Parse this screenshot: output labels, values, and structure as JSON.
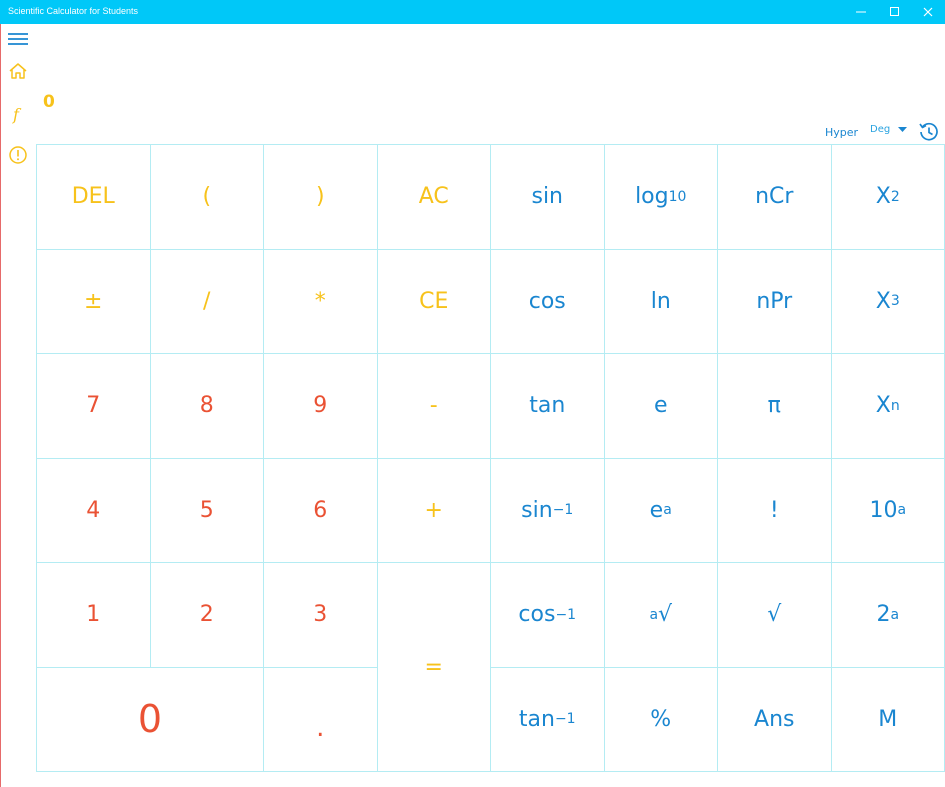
{
  "window": {
    "title": "Scientific Calculator for Students",
    "accent": "#00c8f8"
  },
  "display": {
    "value": "0"
  },
  "options": {
    "hyper_label": "Hyper",
    "angle_mode": "Deg"
  },
  "colors": {
    "operator": "#f7c21b",
    "digit": "#ea5234",
    "function": "#1a86d0",
    "grid": "#b4ecf3"
  },
  "keys": {
    "del": "DEL",
    "lparen": "(",
    "rparen": ")",
    "ac": "AC",
    "sin": "sin",
    "log_base": "log",
    "log_sub": "10",
    "ncr": "nCr",
    "x2_base": "X",
    "x2_sup": "2",
    "plusminus": "±",
    "divide": "/",
    "multiply": "*",
    "ce": "CE",
    "cos": "cos",
    "ln": "ln",
    "npr": "nPr",
    "x3_base": "X",
    "x3_sup": "3",
    "d7": "7",
    "d8": "8",
    "d9": "9",
    "minus": "-",
    "tan": "tan",
    "e": "e",
    "pi": "π",
    "xn_base": "X",
    "xn_sup": "n",
    "d4": "4",
    "d5": "5",
    "d6": "6",
    "plus": "+",
    "asin": "sin",
    "asin_sup": "−1",
    "ea_base": "e",
    "ea_sup": "a",
    "fact": "!",
    "tena_base": "10",
    "tena_sup": "a",
    "d1": "1",
    "d2": "2",
    "d3": "3",
    "equals": "=",
    "acos": "cos",
    "acos_sup": "−1",
    "aroot_sup": "a",
    "aroot_base": "√",
    "sqrt": "√",
    "twoa_base": "2",
    "twoa_sup": "a",
    "d0": "0",
    "dot": ".",
    "atan": "tan",
    "atan_sup": "−1",
    "percent": "%",
    "ans": "Ans",
    "mem": "M"
  }
}
